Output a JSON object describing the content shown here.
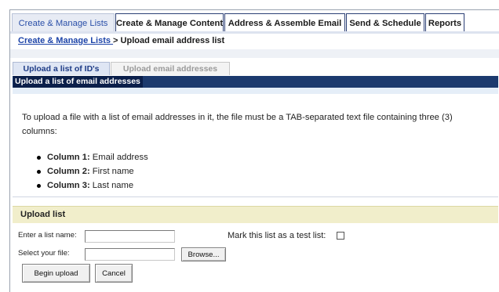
{
  "main_tabs": [
    {
      "label": "Create & Manage Lists",
      "active": true
    },
    {
      "label": "Create & Manage Content",
      "active": false
    },
    {
      "label": "Address & Assemble Email",
      "active": false
    },
    {
      "label": "Send & Schedule",
      "active": false
    },
    {
      "label": "Reports",
      "active": false
    }
  ],
  "breadcrumb": {
    "link": "Create & Manage Lists ",
    "separator": "> ",
    "current": "Upload email address list"
  },
  "sub_tabs": [
    {
      "label": "Upload a list of ID's",
      "active": true
    },
    {
      "label": "Upload email addresses",
      "active": false
    }
  ],
  "section_title": "Upload a list of email addresses",
  "intro_text": "To upload a file with a list of email addresses in it, the file must be a TAB-separated text file containing three (3) columns:",
  "columns": [
    {
      "label": "Column 1:",
      "value": " Email address"
    },
    {
      "label": "Column 2:",
      "value": " First name"
    },
    {
      "label": "Column 3:",
      "value": " Last name"
    }
  ],
  "upload_section": {
    "title": "Upload list",
    "list_name_label": "Enter a list name:",
    "list_name_value": "",
    "file_label": "Select your file:",
    "file_value": "",
    "browse_label": "Browse...",
    "test_list_label": "Mark this list as a test list:",
    "test_list_checked": false,
    "begin_label": "Begin upload",
    "cancel_label": "Cancel"
  },
  "colors": {
    "tab_border": "#2b3f75",
    "active_tab_text": "#2a4fa8",
    "section_bar": "#1c3a6e",
    "upload_header_bg": "#f1eecb",
    "link": "#1d44a8"
  }
}
